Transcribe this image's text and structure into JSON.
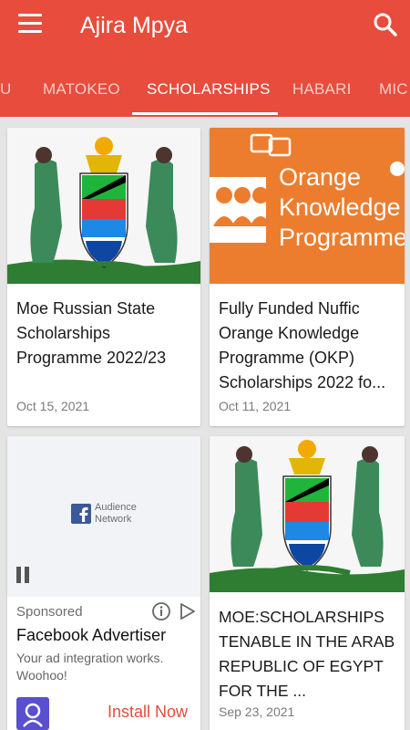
{
  "app": {
    "title": "Ajira Mpya"
  },
  "tabs": [
    {
      "label": "U"
    },
    {
      "label": "MATOKEO"
    },
    {
      "label": "SCHOLARSHIPS"
    },
    {
      "label": "HABARI"
    },
    {
      "label": "MIC"
    }
  ],
  "cards": [
    {
      "title": "Moe Russian State Scholarships Programme 2022/23",
      "date": "Oct 15, 2021",
      "image": "tanzania-coat-of-arms"
    },
    {
      "title": "Fully Funded Nuffic Orange Knowledge Programme (OKP) Scholarships 2022 fo...",
      "date": "Oct 11, 2021",
      "image": "orange-knowledge-programme-banner",
      "image_text": [
        "Orange",
        "Knowledge",
        "Programme"
      ]
    },
    {
      "title": "MOE:SCHOLARSHIPS TENABLE IN THE ARAB REPUBLIC OF EGYPT FOR THE ...",
      "date": "Sep 23, 2021",
      "image": "tanzania-coat-of-arms"
    }
  ],
  "ad": {
    "media_line1": "Audience",
    "media_line2": "Network",
    "sponsored": "Sponsored",
    "title": "Facebook Advertiser",
    "body": "Your ad integration works. Woohoo!",
    "cta": "Install Now"
  },
  "colors": {
    "primary": "#e74c3c",
    "orange": "#ec7d2f",
    "background": "#e4e4e4",
    "ad_logo": "#5a4fcf"
  }
}
